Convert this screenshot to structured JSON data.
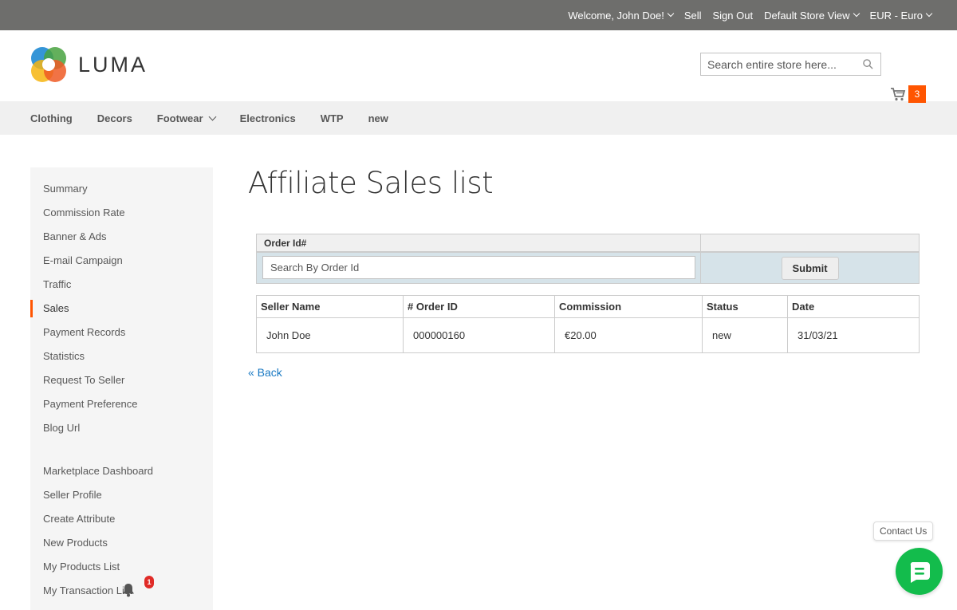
{
  "topbar": {
    "welcome": "Welcome, John Doe!",
    "sell": "Sell",
    "sign_out": "Sign Out",
    "store_view": "Default Store View",
    "currency": "EUR - Euro"
  },
  "header": {
    "logo_text": "LUMA",
    "search_placeholder": "Search entire store here...",
    "cart_count": "3"
  },
  "nav": {
    "items": [
      "Clothing",
      "Decors",
      "Footwear",
      "Electronics",
      "WTP",
      "new"
    ]
  },
  "sidebar": {
    "group1": [
      "Summary",
      "Commission Rate",
      "Banner & Ads",
      "E-mail Campaign",
      "Traffic",
      "Sales",
      "Payment Records",
      "Statistics",
      "Request To Seller",
      "Payment Preference",
      "Blog Url"
    ],
    "group2": [
      "Marketplace Dashboard",
      "Seller Profile",
      "Create Attribute",
      "New Products",
      "My Products List",
      "My Transaction List"
    ],
    "active": "Sales",
    "notification_count": "1"
  },
  "main": {
    "title": "Affiliate Sales list",
    "filter": {
      "header_label": "Order Id#",
      "search_placeholder": "Search By Order Id",
      "submit_label": "Submit"
    },
    "table": {
      "headers": [
        "Seller Name",
        "# Order ID",
        "Commission",
        "Status",
        "Date"
      ],
      "rows": [
        [
          "John Doe",
          "000000160",
          "€20.00",
          "new",
          "31/03/21"
        ]
      ]
    },
    "back_label": "« Back"
  },
  "contact": {
    "label": "Contact Us"
  },
  "colors": {
    "accent": "#ff5501",
    "link": "#1979c3",
    "chat": "#13bc4c",
    "topbar": "#6e6e6c"
  }
}
